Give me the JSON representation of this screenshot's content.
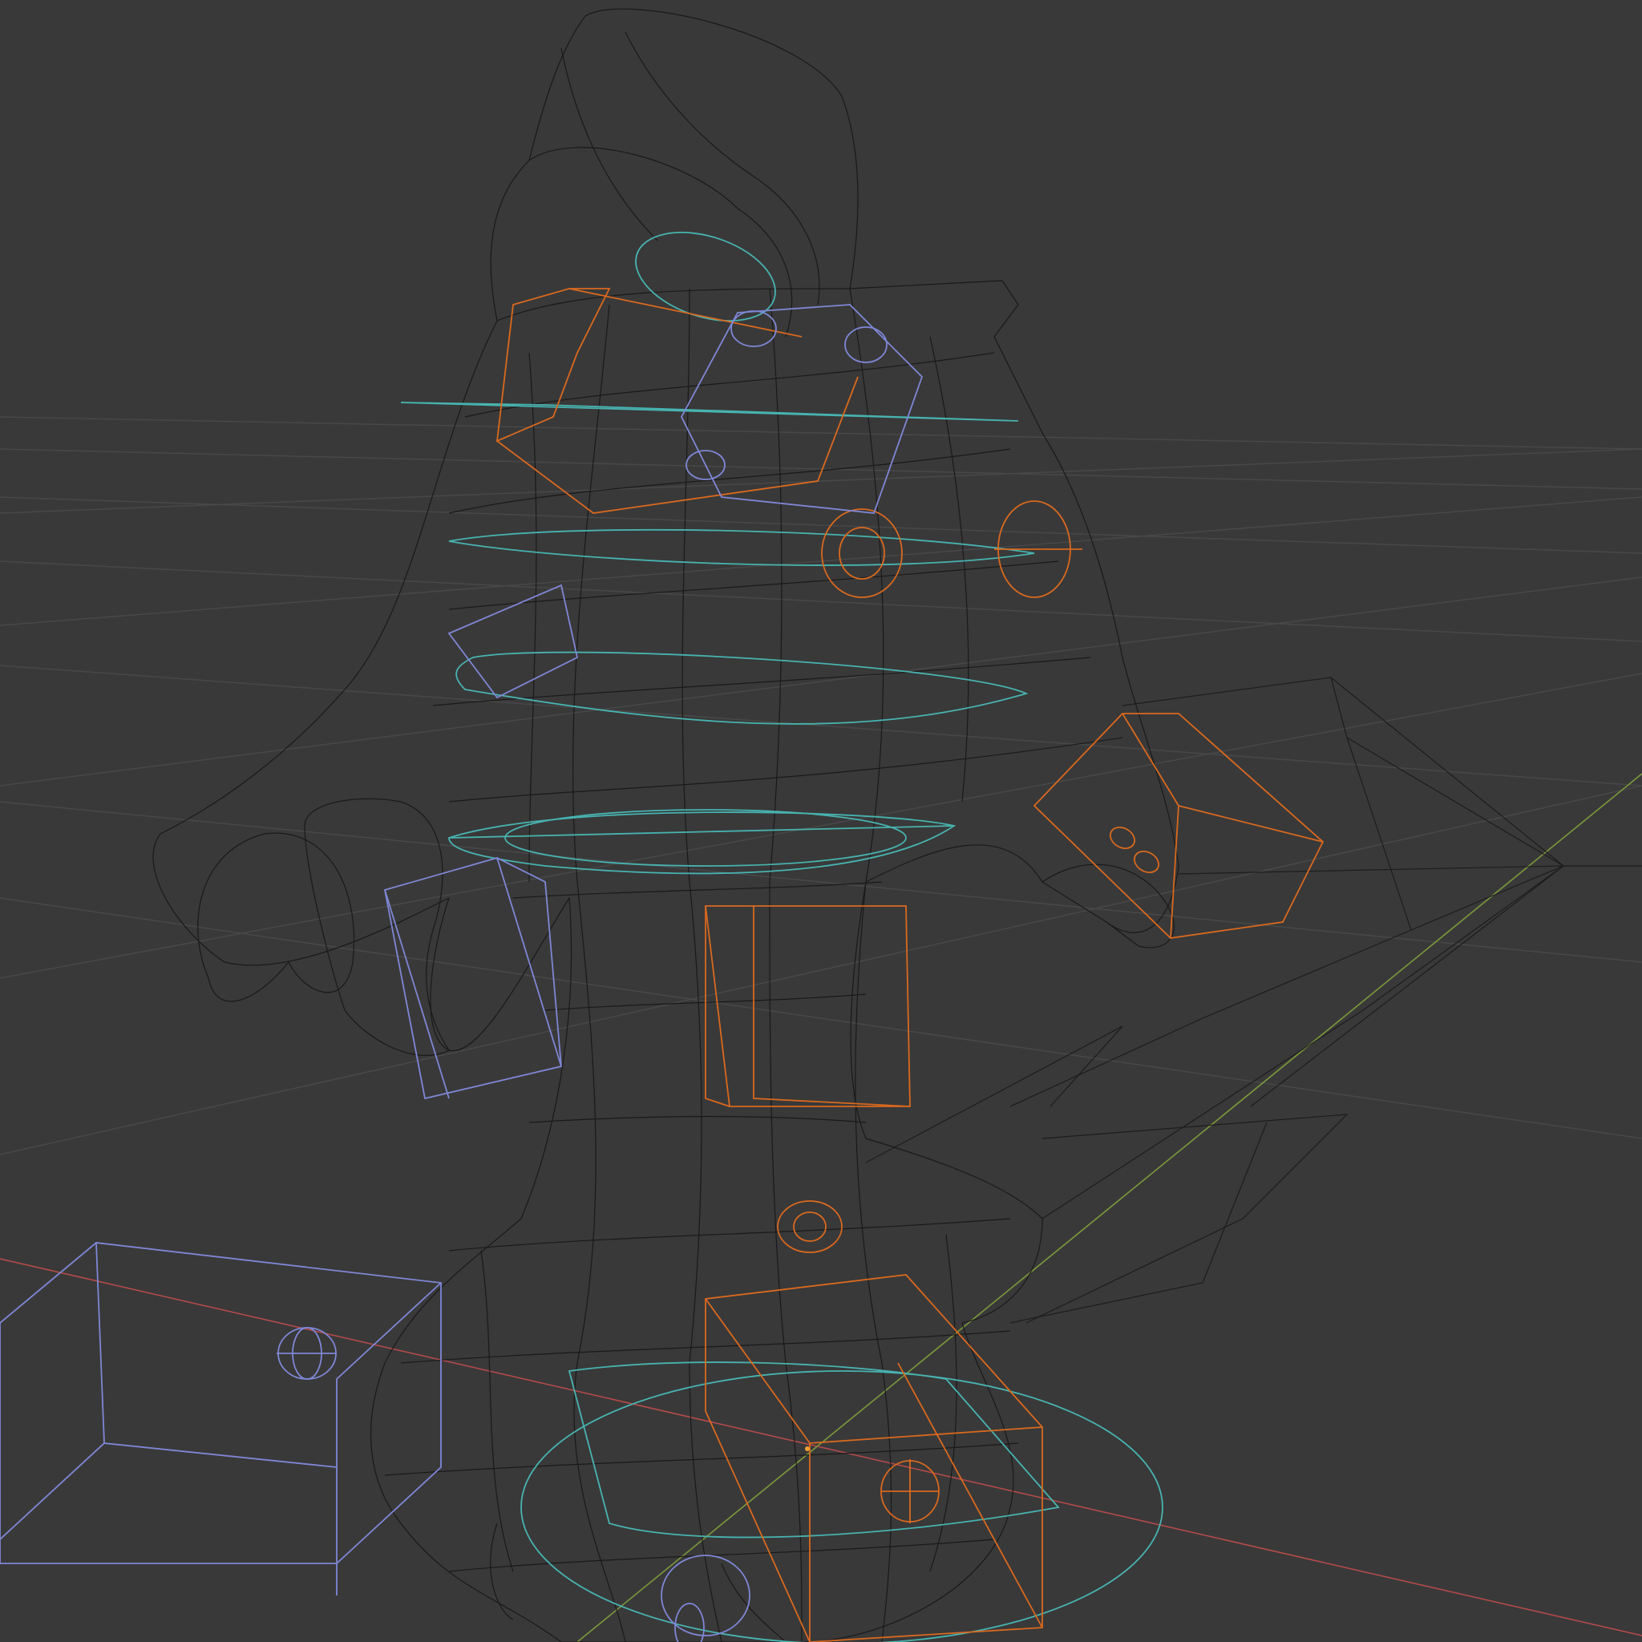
{
  "viewport": {
    "mode": "wireframe",
    "grid_visible": true,
    "axes_visible": [
      "x",
      "y"
    ],
    "colors": {
      "background": "#393939",
      "grid": "#4a4a4a",
      "x_axis": "#b34a4a",
      "y_axis": "#7d9a3c",
      "mesh_wire": "#111111",
      "control_cyan": "#48b3b0",
      "control_orange": "#d9691f",
      "control_blue": "#7f87d6",
      "origin": "#f0a030"
    },
    "visible_objects": [
      "character-mesh",
      "cyan-ring-controls",
      "orange-box-controls",
      "blue-box-controls",
      "ik-target-lines"
    ]
  }
}
